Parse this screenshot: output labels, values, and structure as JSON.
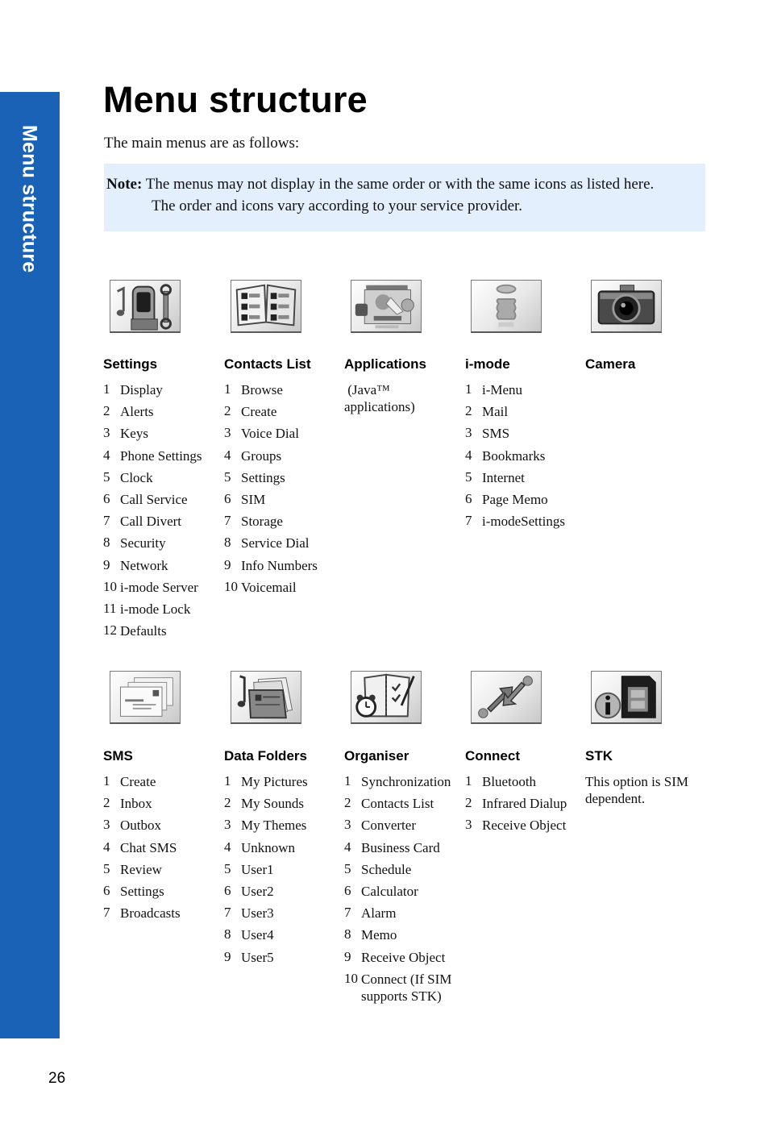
{
  "side_tab": {
    "label": "Menu structure",
    "color": "#1a62b6"
  },
  "header": {
    "title": "Menu structure",
    "intro": "The main menus are as follows:"
  },
  "note": {
    "label": "Note:",
    "line1": "The menus may not display in the same order or with the same icons as listed here.",
    "line2": "The order and icons vary according to your service provider.",
    "background": "#e3effd"
  },
  "menus": [
    {
      "title": "Settings",
      "icon": "settings-icon",
      "items": [
        {
          "n": "1",
          "label": "Display"
        },
        {
          "n": "2",
          "label": "Alerts"
        },
        {
          "n": "3",
          "label": "Keys"
        },
        {
          "n": "4",
          "label": "Phone Settings"
        },
        {
          "n": "5",
          "label": "Clock"
        },
        {
          "n": "6",
          "label": "Call Service"
        },
        {
          "n": "7",
          "label": "Call Divert"
        },
        {
          "n": "8",
          "label": "Security"
        },
        {
          "n": "9",
          "label": "Network"
        },
        {
          "n": "10",
          "label": "i-mode Server"
        },
        {
          "n": "11",
          "label": "i-mode Lock"
        },
        {
          "n": "12",
          "label": "Defaults"
        }
      ]
    },
    {
      "title": "Contacts List",
      "icon": "contacts-book-icon",
      "items": [
        {
          "n": "1",
          "label": "Browse"
        },
        {
          "n": "2",
          "label": "Create"
        },
        {
          "n": "3",
          "label": "Voice Dial"
        },
        {
          "n": "4",
          "label": "Groups"
        },
        {
          "n": "5",
          "label": "Settings"
        },
        {
          "n": "6",
          "label": "SIM"
        },
        {
          "n": "7",
          "label": "Storage"
        },
        {
          "n": "8",
          "label": "Service Dial"
        },
        {
          "n": "9",
          "label": "Info Numbers"
        },
        {
          "n": "10",
          "label": "Voicemail"
        }
      ]
    },
    {
      "title": "Applications",
      "icon": "applications-icon",
      "description_line1": " (Java™",
      "description_line2": "applications)"
    },
    {
      "title": "i-mode",
      "icon": "i-mode-icon",
      "items": [
        {
          "n": "1",
          "label": "i-Menu"
        },
        {
          "n": "2",
          "label": "Mail"
        },
        {
          "n": "3",
          "label": "SMS"
        },
        {
          "n": "4",
          "label": "Bookmarks"
        },
        {
          "n": "5",
          "label": "Internet"
        },
        {
          "n": "6",
          "label": "Page Memo"
        },
        {
          "n": "7",
          "label": "i-modeSettings"
        }
      ]
    },
    {
      "title": "Camera",
      "icon": "camera-icon"
    },
    {
      "title": "SMS",
      "icon": "envelopes-icon",
      "items": [
        {
          "n": "1",
          "label": "Create"
        },
        {
          "n": "2",
          "label": "Inbox"
        },
        {
          "n": "3",
          "label": "Outbox"
        },
        {
          "n": "4",
          "label": "Chat SMS"
        },
        {
          "n": "5",
          "label": "Review"
        },
        {
          "n": "6",
          "label": "Settings"
        },
        {
          "n": "7",
          "label": "Broadcasts"
        }
      ]
    },
    {
      "title": "Data Folders",
      "icon": "data-folder-icon",
      "items": [
        {
          "n": "1",
          "label": "My Pictures"
        },
        {
          "n": "2",
          "label": "My Sounds"
        },
        {
          "n": "3",
          "label": "My Themes"
        },
        {
          "n": "4",
          "label": "Unknown"
        },
        {
          "n": "5",
          "label": "User1"
        },
        {
          "n": "6",
          "label": "User2"
        },
        {
          "n": "7",
          "label": "User3"
        },
        {
          "n": "8",
          "label": "User4"
        },
        {
          "n": "9",
          "label": "User5"
        }
      ]
    },
    {
      "title": "Organiser",
      "icon": "organiser-icon",
      "items": [
        {
          "n": "1",
          "label": "Synchronization"
        },
        {
          "n": "2",
          "label": "Contacts List"
        },
        {
          "n": "3",
          "label": "Converter"
        },
        {
          "n": "4",
          "label": "Business Card"
        },
        {
          "n": "5",
          "label": "Schedule"
        },
        {
          "n": "6",
          "label": "Calculator"
        },
        {
          "n": "7",
          "label": "Alarm"
        },
        {
          "n": "8",
          "label": "Memo"
        },
        {
          "n": "9",
          "label": "Receive Object"
        },
        {
          "n": "10",
          "label": "Connect (If SIM supports STK)"
        }
      ]
    },
    {
      "title": "Connect",
      "icon": "connect-arrows-icon",
      "items": [
        {
          "n": "1",
          "label": "Bluetooth"
        },
        {
          "n": "2",
          "label": "Infrared Dialup"
        },
        {
          "n": "3",
          "label": "Receive Object"
        }
      ]
    },
    {
      "title": "STK",
      "icon": "sim-info-icon",
      "description_line1": "This option is SIM",
      "description_line2": "dependent."
    }
  ],
  "footer": {
    "page_number": "26"
  }
}
